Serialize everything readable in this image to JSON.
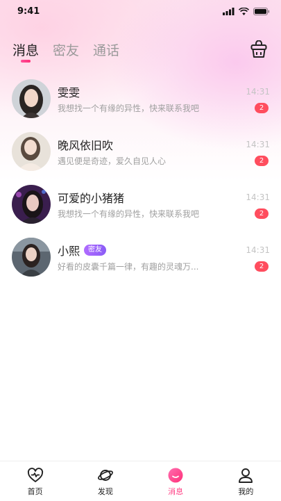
{
  "status_bar": {
    "time": "9:41"
  },
  "tabs": [
    {
      "label": "消息",
      "active": true
    },
    {
      "label": "密友",
      "active": false
    },
    {
      "label": "通话",
      "active": false
    }
  ],
  "conversations": [
    {
      "name": "雯雯",
      "preview": "我想找一个有缘的异性，快来联系我吧",
      "time": "14:31",
      "unread": "2",
      "tag": ""
    },
    {
      "name": "晚风依旧吹",
      "preview": "遇见便是奇迹，爱久自见人心",
      "time": "14:31",
      "unread": "2",
      "tag": ""
    },
    {
      "name": "可爱的小猪猪",
      "preview": "我想找一个有缘的异性，快来联系我吧",
      "time": "14:31",
      "unread": "2",
      "tag": ""
    },
    {
      "name": "小熙",
      "preview": "好看的皮囊千篇一律，有趣的灵魂万...",
      "time": "14:31",
      "unread": "2",
      "tag": "密友"
    }
  ],
  "tabbar": [
    {
      "label": "首页",
      "icon": "heart-pulse-icon"
    },
    {
      "label": "发现",
      "icon": "planet-icon"
    },
    {
      "label": "消息",
      "icon": "message-bubble-icon",
      "active": true
    },
    {
      "label": "我的",
      "icon": "user-icon"
    }
  ],
  "colors": {
    "accent": "#ff3d83",
    "badge": "#ff4d5e",
    "tag": "#9b63f8"
  }
}
